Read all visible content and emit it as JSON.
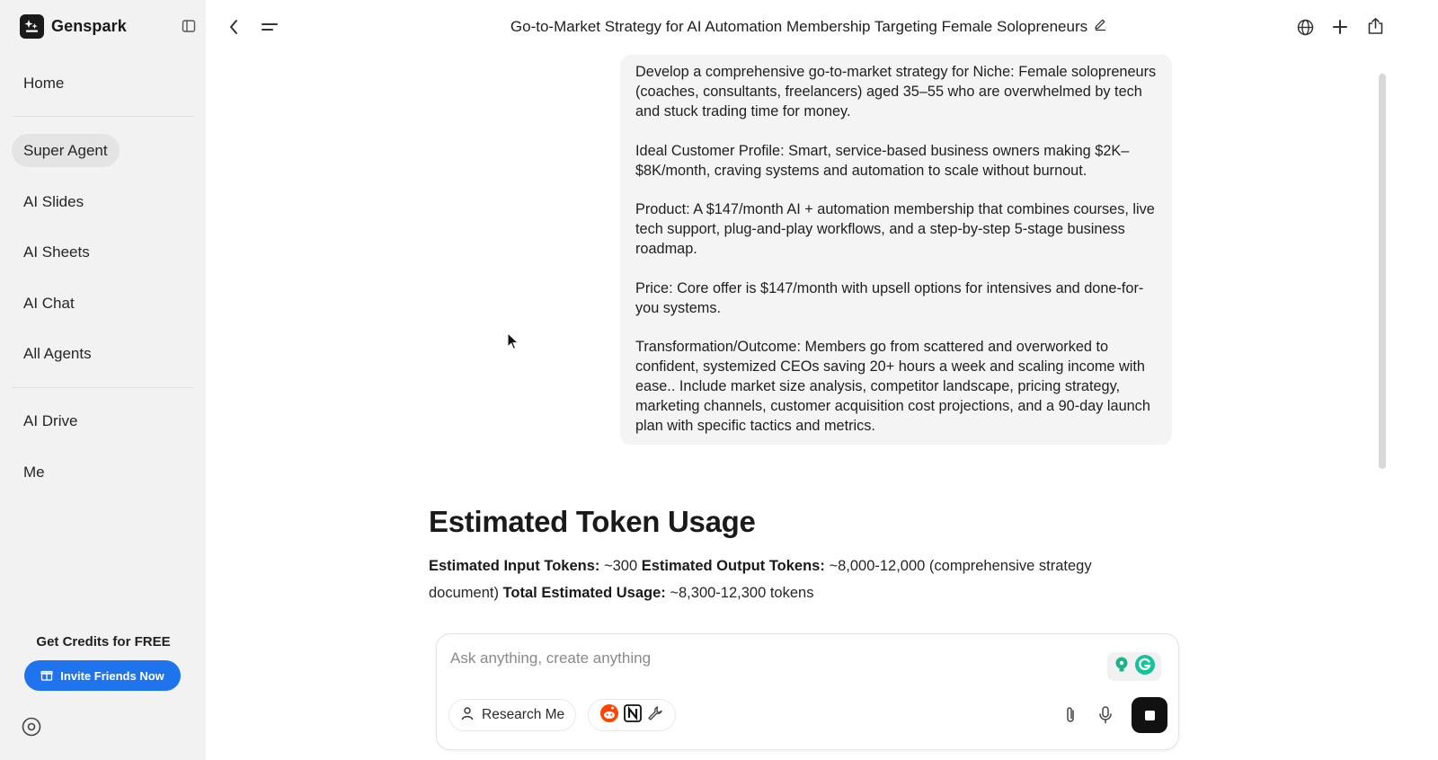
{
  "app": {
    "name": "Genspark"
  },
  "sidebar": {
    "items": [
      {
        "label": "Home"
      },
      {
        "label": "Super Agent"
      },
      {
        "label": "AI Slides"
      },
      {
        "label": "AI Sheets"
      },
      {
        "label": "AI Chat"
      },
      {
        "label": "All Agents"
      },
      {
        "label": "AI Drive"
      },
      {
        "label": "Me"
      }
    ],
    "active_item": "Super Agent",
    "credits": {
      "title": "Get Credits for FREE",
      "button_label": "Invite Friends Now"
    }
  },
  "header": {
    "title": "Go-to-Market Strategy for AI Automation Membership Targeting Female Solopreneurs"
  },
  "message": {
    "paragraphs": [
      "Develop a comprehensive go-to-market strategy for Niche: Female solopreneurs (coaches, consultants, freelancers) aged 35–55 who are overwhelmed by tech and stuck trading time for money.",
      "Ideal Customer Profile: Smart, service-based business owners making $2K–$8K/month, craving systems and automation to scale without burnout.",
      "Product: A $147/month AI + automation membership that combines courses, live tech support, plug-and-play workflows, and a step-by-step 5-stage business roadmap.",
      "Price: Core offer is $147/month with upsell options for intensives and done-for-you systems.",
      "Transformation/Outcome: Members go from scattered and overworked to confident, systemized CEOs saving 20+ hours a week and scaling income with ease.. Include market size analysis, competitor landscape, pricing strategy, marketing channels, customer acquisition cost projections, and a 90-day launch plan with specific tactics and metrics."
    ]
  },
  "token_usage": {
    "heading": "Estimated Token Usage",
    "input_label": "Estimated Input Tokens:",
    "input_value": " ~300 ",
    "output_label": "Estimated Output Tokens:",
    "output_value": " ~8,000-12,000 (comprehensive strategy document) ",
    "total_label": "Total Estimated Usage:",
    "total_value": " ~8,300-12,300 tokens"
  },
  "composer": {
    "placeholder": "Ask anything, create anything",
    "chip_label": "Research Me"
  },
  "icons": {
    "brand": "genspark-logo-icon",
    "collapse": "sidebar-toggle-icon",
    "back": "chevron-left-icon",
    "menu": "menu-lines-icon",
    "edit": "pencil-icon",
    "globe": "globe-icon",
    "new": "plus-icon",
    "share": "share-icon",
    "gift": "gift-icon",
    "settings": "settings-icon",
    "person": "person-icon",
    "reddit": "reddit-icon",
    "notion": "notion-icon",
    "tools": "wrench-icon",
    "attach": "paperclip-icon",
    "mic": "microphone-icon",
    "stop": "stop-icon"
  },
  "colors": {
    "accent": "#1f74ee",
    "sidebar_bg": "#f2f2f2",
    "bubble_bg": "#f4f4f4"
  }
}
